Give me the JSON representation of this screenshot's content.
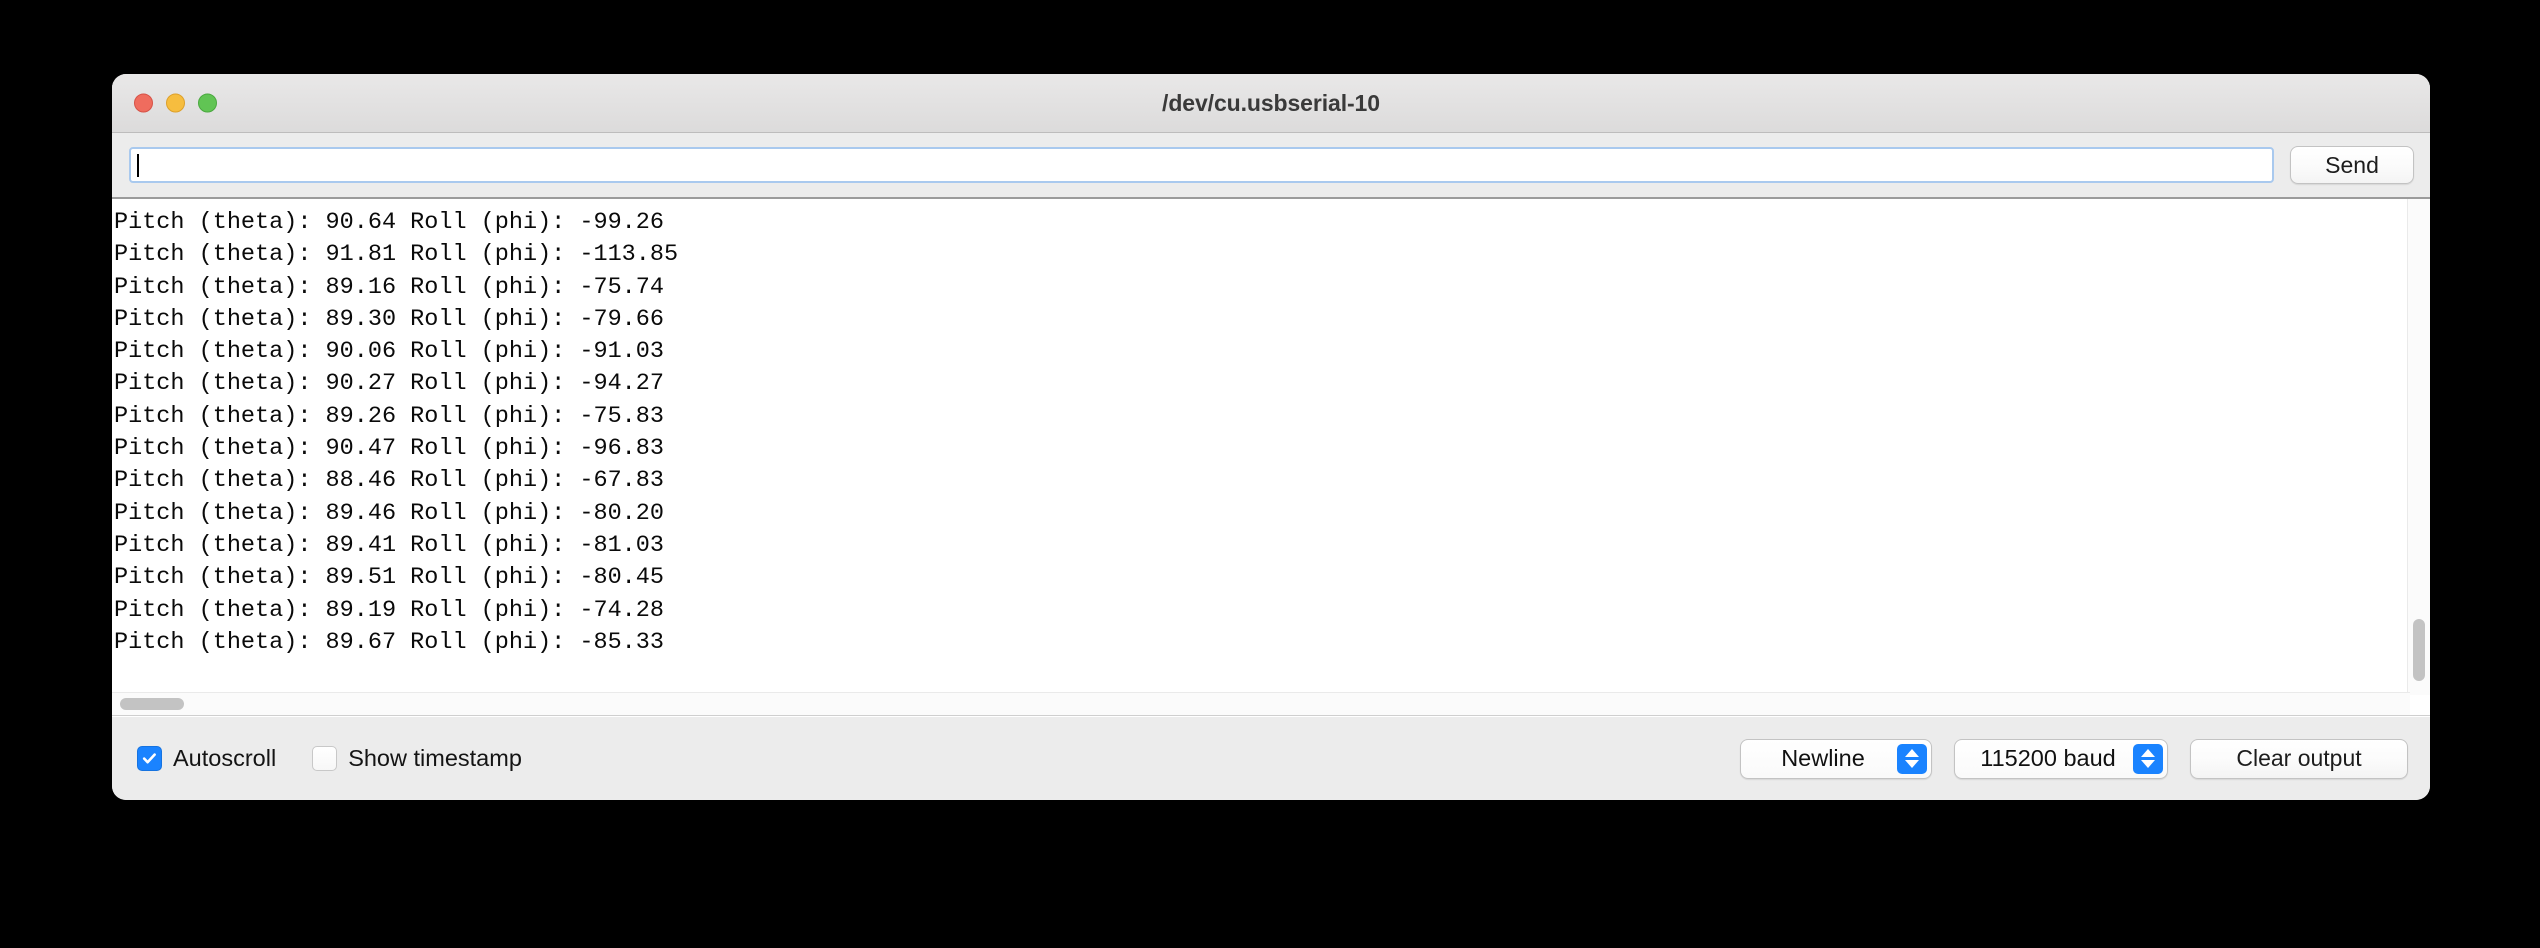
{
  "window": {
    "title": "/dev/cu.usbserial-10",
    "traffic_lights": [
      {
        "name": "close",
        "color": "#ef6c5e"
      },
      {
        "name": "minimize",
        "color": "#f6bd3f"
      },
      {
        "name": "maximize",
        "color": "#61c454"
      }
    ]
  },
  "send_bar": {
    "input_value": "",
    "input_placeholder": "",
    "send_label": "Send"
  },
  "output": {
    "lines": [
      "Pitch (theta): 90.64 Roll (phi): -99.26",
      "Pitch (theta): 91.81 Roll (phi): -113.85",
      "Pitch (theta): 89.16 Roll (phi): -75.74",
      "Pitch (theta): 89.30 Roll (phi): -79.66",
      "Pitch (theta): 90.06 Roll (phi): -91.03",
      "Pitch (theta): 90.27 Roll (phi): -94.27",
      "Pitch (theta): 89.26 Roll (phi): -75.83",
      "Pitch (theta): 90.47 Roll (phi): -96.83",
      "Pitch (theta): 88.46 Roll (phi): -67.83",
      "Pitch (theta): 89.46 Roll (phi): -80.20",
      "Pitch (theta): 89.41 Roll (phi): -81.03",
      "Pitch (theta): 89.51 Roll (phi): -80.45",
      "Pitch (theta): 89.19 Roll (phi): -74.28",
      "Pitch (theta): 89.67 Roll (phi): -85.33"
    ],
    "text": "Pitch (theta): 90.64 Roll (phi): -99.26\nPitch (theta): 91.81 Roll (phi): -113.85\nPitch (theta): 89.16 Roll (phi): -75.74\nPitch (theta): 89.30 Roll (phi): -79.66\nPitch (theta): 90.06 Roll (phi): -91.03\nPitch (theta): 90.27 Roll (phi): -94.27\nPitch (theta): 89.26 Roll (phi): -75.83\nPitch (theta): 90.47 Roll (phi): -96.83\nPitch (theta): 88.46 Roll (phi): -67.83\nPitch (theta): 89.46 Roll (phi): -80.20\nPitch (theta): 89.41 Roll (phi): -81.03\nPitch (theta): 89.51 Roll (phi): -80.45\nPitch (theta): 89.19 Roll (phi): -74.28\nPitch (theta): 89.67 Roll (phi): -85.33"
  },
  "bottom_bar": {
    "autoscroll": {
      "label": "Autoscroll",
      "checked": true
    },
    "show_timestamp": {
      "label": "Show timestamp",
      "checked": false
    },
    "line_ending": {
      "selected": "Newline"
    },
    "baud_rate": {
      "selected": "115200 baud"
    },
    "clear_output_label": "Clear output"
  },
  "colors": {
    "accent_blue": "#1a83ff",
    "focus_border": "#a9c9ee",
    "window_chrome": "#ececec",
    "desktop_background": "#000000"
  }
}
